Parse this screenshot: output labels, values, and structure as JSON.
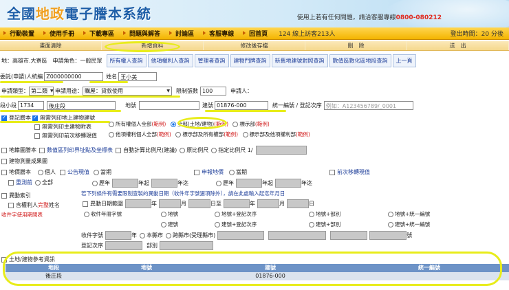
{
  "header": {
    "logo_pre": "全國",
    "logo_hl": "地政",
    "logo_post": "電子謄本系統",
    "contact_prefix": "使用上若有任何問題，請洽客服專線",
    "contact_phone": "0800-080212"
  },
  "nav": {
    "items": [
      "行動裝置",
      "使用手冊",
      "下載專區",
      "問題與解答",
      "討論區",
      "客服專線",
      "回首頁"
    ],
    "online": "124 線上訪客213人",
    "logout": "登出時間：20 分後"
  },
  "actions": [
    "畫面清除",
    "新增資料",
    "修改後存檔",
    "刪　除",
    "送　出"
  ],
  "sub": {
    "info": "地：高雄市.大寮區　申請角色：一般民眾",
    "buttons": [
      "所有權人查詢",
      "他項權利人查詢",
      "管理者查詢",
      "建物門牌查詢",
      "新舊地建號對照查詢",
      "數值區數化區地段查詢",
      "上一頁"
    ]
  },
  "form": {
    "agent_label": "委託(申請)人統編",
    "agent_value": "Z000000000",
    "name_label": "姓名",
    "name_value": "王小美",
    "type_label": "申請類型：",
    "type_value": "第二類",
    "purpose_label": "申請用途：",
    "purpose_value": "購屋：貸款使用",
    "limit_label": "限制張數",
    "limit_value": "100",
    "applicant_label": "申請人：",
    "section_label": "段小段",
    "section_code": "1734",
    "section_name": "後庄段",
    "lot_label": "地號",
    "lot_value": "",
    "bldg_label": "建號",
    "bldg_value": "01876-000",
    "uid_label": "統一編號 / 登記次序",
    "uid_placeholder": "例如：A123456789/_0001"
  },
  "transcript": {
    "label": "登記謄本",
    "opt1": "無需列印地上建物建號",
    "opt2": "無需列印主建物附表",
    "opt3": "無需列印前次移轉現值",
    "r1": "所有權個人全部",
    "r2": "全部(土地/建物)",
    "r3": "標示部",
    "r4": "他項權利個人全部",
    "r5": "標示部及所有權部",
    "r6": "標示部及他項權利部",
    "range": "(範例)"
  },
  "cadastral": {
    "label": "地籍圖謄本",
    "opt1": "數值區列印界址點及坐標表",
    "opt2": "自動計算比例尺(建議)",
    "opt3": "原比例尺",
    "opt4": "指定比例尺 1/"
  },
  "building_map": {
    "label": "建物測量成果圖"
  },
  "price": {
    "label": "地價謄本",
    "personal": "個人",
    "public_value": "公告現值",
    "current": "當期",
    "declared": "申報地價",
    "current2": "當期",
    "prev_transfer": "前次移轉現值",
    "redo": "重測前",
    "all": "全部",
    "history": "歷年",
    "year_to": "年迄",
    "year_from": "年起"
  },
  "change": {
    "label": "異動索引",
    "note": "若下列條件有需要限制查製的異動日期（收件年字號選項除外），請在此處輸入起迄年月日",
    "owner": "含權利人",
    "complete": "完整",
    "name_suffix": "姓名",
    "date_range": "異動日期範圍",
    "year": "年",
    "month": "月",
    "day": "日至",
    "day_end": "日",
    "tip": "收件字使用期間表",
    "recv_no": "收件年冊字號",
    "lot": "地號",
    "lot_order": "地號+登記次序",
    "lot_part": "地號+部別",
    "lot_uid": "地號+統一編號",
    "bldg": "建號",
    "bldg_order": "建號+登記次序",
    "bldg_part": "建號+部別",
    "bldg_uid": "建號+統一編號",
    "recv_word": "收件字號",
    "this_city": "本縣市",
    "cross": "跨縣市(受理縣市)",
    "num": "號",
    "order": "登記次序",
    "part": "部別"
  },
  "ref": {
    "label": "土地/建物參考資訊"
  },
  "table": {
    "headers": [
      "地段",
      "地號",
      "建號",
      "統一編號"
    ],
    "row": [
      "後庄段",
      "",
      "01876-000",
      ""
    ]
  }
}
